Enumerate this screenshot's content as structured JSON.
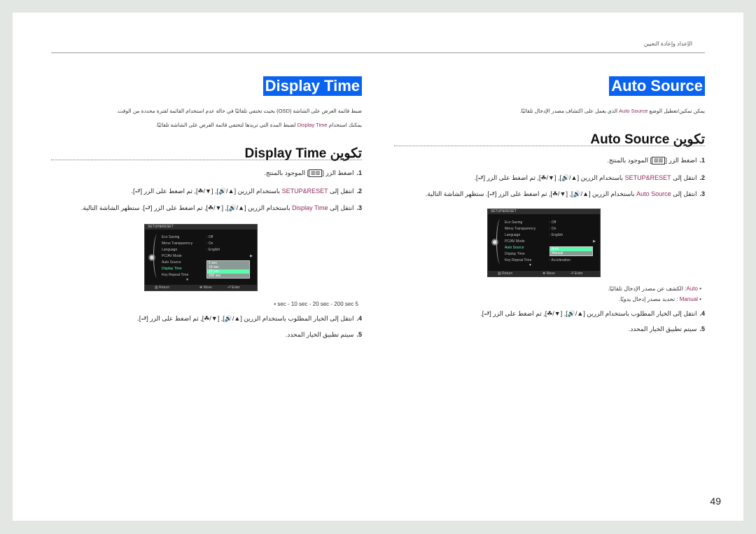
{
  "header": {
    "section_title": "الإعداد وإعادة التعيين"
  },
  "page_number": "49",
  "left_section": {
    "title": "Display Time",
    "desc1": "ضبط قائمة العرض على الشاشة (OSD) بحيث تختفي تلقائيًا في حالة عدم استخدام القائمة لفترة محددة من الوقت.",
    "desc2_pre": "يمكنك استخدام ",
    "desc2_hl": "Display Time",
    "desc2_post": " لضبط المدة التي تريدها لتختفي قائمة العرض على الشاشة تلقائيًا.",
    "subheading": "تكوين Display Time",
    "steps": [
      {
        "num": "1.",
        "pre": "اضغط الزر [",
        "icon": "menu",
        "post": "] الموجود بالمنتج."
      },
      {
        "num": "2.",
        "pre": "انتقل إلى ",
        "hl": "SETUP&RESET",
        "post": " باستخدام الزرين [▲/🔊], [▼/☘], ثم اضغط على الزر [⮐]."
      },
      {
        "num": "3.",
        "pre": "انتقل إلى ",
        "hl": "Display Time",
        "post": " باستخدام الزرين [▲/🔊], [▼/☘], ثم اضغط على الزر [⮐]. ستظهر الشاشة التالية."
      },
      {
        "num": "4.",
        "pre": "انتقل إلى الخيار المطلوب باستخدام الزرين [▲/🔊], [▼/☘], ثم اضغط على الزر [⮐]."
      },
      {
        "num": "5.",
        "pre": "سيتم تطبيق الخيار المحدد."
      }
    ],
    "options_line": "5 sec - 10 sec - 20 sec - 200 sec",
    "osd": {
      "title": "SETUP&RESET",
      "rows": [
        {
          "label": "Eco Saving",
          "value": ": Off"
        },
        {
          "label": "Menu Transparency",
          "value": ": On"
        },
        {
          "label": "Language",
          "value": ": English"
        },
        {
          "label": "PC/AV Mode",
          "value": ""
        },
        {
          "label": "Auto Source",
          "value": ":"
        },
        {
          "label": "Display Time",
          "value": ":"
        },
        {
          "label": "Key Repeat Time",
          "value": ":"
        }
      ],
      "dropdown": [
        "5 sec",
        "10 sec",
        "20 sec",
        "200 sec"
      ],
      "dropdown_selected": 2,
      "footer": {
        "return": "Return",
        "move": "Move",
        "enter": "Enter"
      }
    }
  },
  "right_section": {
    "title": "Auto Source",
    "desc_pre": "يمكن تمكين/تعطيل الوضع ",
    "desc_hl": "Auto Source",
    "desc_post": " الذي يعمل على اكتشاف مصدر الإدخال تلقائيًا.",
    "subheading": "تكوين Auto Source",
    "steps": [
      {
        "num": "1.",
        "pre": "اضغط الزر [",
        "icon": "menu",
        "post": "] الموجود بالمنتج."
      },
      {
        "num": "2.",
        "pre": "انتقل إلى ",
        "hl": "SETUP&RESET",
        "post": " باستخدام الزرين [▲/🔊], [▼/☘], ثم اضغط على الزر [⮐]."
      },
      {
        "num": "3.",
        "pre": "انتقل إلى ",
        "hl": "Auto Source",
        "post": " باستخدام الزرين [▲/🔊], [▼/☘], ثم اضغط على الزر [⮐]. ستظهر الشاشة التالية."
      },
      {
        "num": "4.",
        "pre": "انتقل إلى الخيار المطلوب باستخدام الزرين [▲/🔊], [▼/☘], ثم اضغط على الزر [⮐]."
      },
      {
        "num": "5.",
        "pre": "سيتم تطبيق الخيار المحدد."
      }
    ],
    "bullets": [
      {
        "hl": "Auto",
        "text": ": الكشف عن مصدر الإدخال تلقائيًا."
      },
      {
        "hl": "Manual",
        "text": " : تحديد مصدر إدخال يدويًا."
      }
    ],
    "osd": {
      "title": "SETUP&RESET",
      "rows": [
        {
          "label": "Eco Saving",
          "value": ": Off"
        },
        {
          "label": "Menu Transparency",
          "value": ": On"
        },
        {
          "label": "Language",
          "value": ": English"
        },
        {
          "label": "PC/AV Mode",
          "value": ""
        },
        {
          "label": "Auto Source",
          "value": ":"
        },
        {
          "label": "Display Time",
          "value": ":"
        },
        {
          "label": "Key Repeat Time",
          "value": ": Acceleration"
        }
      ],
      "dropdown": [
        "Auto",
        "Manual"
      ],
      "dropdown_selected": 0,
      "footer": {
        "return": "Return",
        "move": "Move",
        "enter": "Enter"
      }
    }
  }
}
